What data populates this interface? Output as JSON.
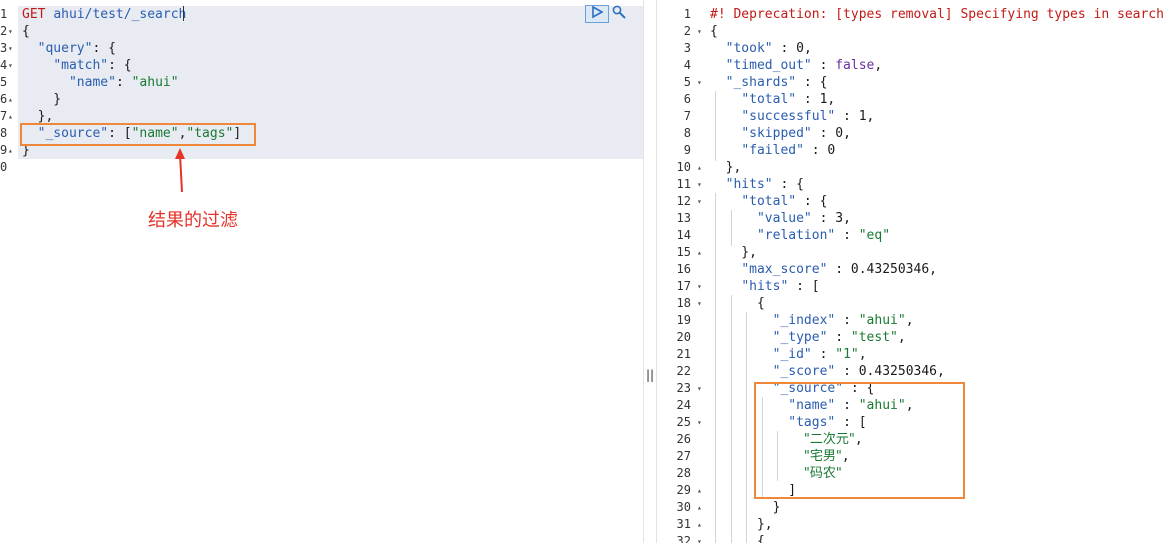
{
  "request": {
    "lines": [
      {
        "n": "1",
        "fold": "",
        "parts": [
          {
            "c": "meth",
            "t": "GET "
          },
          {
            "c": "url",
            "t": "ahui/test/_search"
          }
        ]
      },
      {
        "n": "2",
        "fold": "▾",
        "parts": [
          {
            "c": "pun",
            "t": "{"
          }
        ]
      },
      {
        "n": "3",
        "fold": "▾",
        "parts": [
          {
            "c": "pun",
            "t": "  "
          },
          {
            "c": "key",
            "t": "\"query\""
          },
          {
            "c": "pun",
            "t": ": {"
          }
        ]
      },
      {
        "n": "4",
        "fold": "▾",
        "parts": [
          {
            "c": "pun",
            "t": "    "
          },
          {
            "c": "key",
            "t": "\"match\""
          },
          {
            "c": "pun",
            "t": ": {"
          }
        ]
      },
      {
        "n": "5",
        "fold": "",
        "parts": [
          {
            "c": "pun",
            "t": "      "
          },
          {
            "c": "key",
            "t": "\"name\""
          },
          {
            "c": "pun",
            "t": ": "
          },
          {
            "c": "str",
            "t": "\"ahui\""
          }
        ]
      },
      {
        "n": "6",
        "fold": "▴",
        "parts": [
          {
            "c": "pun",
            "t": "    }"
          }
        ]
      },
      {
        "n": "7",
        "fold": "▴",
        "parts": [
          {
            "c": "pun",
            "t": "  },"
          }
        ]
      },
      {
        "n": "8",
        "fold": "",
        "parts": [
          {
            "c": "pun",
            "t": "  "
          },
          {
            "c": "key",
            "t": "\"_source\""
          },
          {
            "c": "pun",
            "t": ": ["
          },
          {
            "c": "str",
            "t": "\"name\""
          },
          {
            "c": "pun",
            "t": ","
          },
          {
            "c": "str",
            "t": "\"tags\""
          },
          {
            "c": "pun",
            "t": "]"
          }
        ]
      },
      {
        "n": "9",
        "fold": "▴",
        "parts": [
          {
            "c": "pun",
            "t": "}"
          }
        ]
      },
      {
        "n": "0",
        "fold": "",
        "parts": []
      }
    ],
    "annotation": "结果的过滤"
  },
  "response": {
    "lines": [
      {
        "n": "1",
        "fold": "",
        "parts": [
          {
            "c": "cmt",
            "t": "#! Deprecation: [types removal] Specifying types in search r"
          }
        ]
      },
      {
        "n": "2",
        "fold": "▾",
        "parts": [
          {
            "c": "pun",
            "t": "{"
          }
        ]
      },
      {
        "n": "3",
        "fold": "",
        "parts": [
          {
            "c": "pun",
            "t": "  "
          },
          {
            "c": "key",
            "t": "\"took\""
          },
          {
            "c": "pun",
            "t": " : "
          },
          {
            "c": "num",
            "t": "0"
          },
          {
            "c": "pun",
            "t": ","
          }
        ]
      },
      {
        "n": "4",
        "fold": "",
        "parts": [
          {
            "c": "pun",
            "t": "  "
          },
          {
            "c": "key",
            "t": "\"timed_out\""
          },
          {
            "c": "pun",
            "t": " : "
          },
          {
            "c": "kw",
            "t": "false"
          },
          {
            "c": "pun",
            "t": ","
          }
        ]
      },
      {
        "n": "5",
        "fold": "▾",
        "parts": [
          {
            "c": "pun",
            "t": "  "
          },
          {
            "c": "key",
            "t": "\"_shards\""
          },
          {
            "c": "pun",
            "t": " : {"
          }
        ]
      },
      {
        "n": "6",
        "fold": "",
        "parts": [
          {
            "c": "pun",
            "t": "    "
          },
          {
            "c": "key",
            "t": "\"total\""
          },
          {
            "c": "pun",
            "t": " : "
          },
          {
            "c": "num",
            "t": "1"
          },
          {
            "c": "pun",
            "t": ","
          }
        ]
      },
      {
        "n": "7",
        "fold": "",
        "parts": [
          {
            "c": "pun",
            "t": "    "
          },
          {
            "c": "key",
            "t": "\"successful\""
          },
          {
            "c": "pun",
            "t": " : "
          },
          {
            "c": "num",
            "t": "1"
          },
          {
            "c": "pun",
            "t": ","
          }
        ]
      },
      {
        "n": "8",
        "fold": "",
        "parts": [
          {
            "c": "pun",
            "t": "    "
          },
          {
            "c": "key",
            "t": "\"skipped\""
          },
          {
            "c": "pun",
            "t": " : "
          },
          {
            "c": "num",
            "t": "0"
          },
          {
            "c": "pun",
            "t": ","
          }
        ]
      },
      {
        "n": "9",
        "fold": "",
        "parts": [
          {
            "c": "pun",
            "t": "    "
          },
          {
            "c": "key",
            "t": "\"failed\""
          },
          {
            "c": "pun",
            "t": " : "
          },
          {
            "c": "num",
            "t": "0"
          }
        ]
      },
      {
        "n": "10",
        "fold": "▴",
        "parts": [
          {
            "c": "pun",
            "t": "  },"
          }
        ]
      },
      {
        "n": "11",
        "fold": "▾",
        "parts": [
          {
            "c": "pun",
            "t": "  "
          },
          {
            "c": "key",
            "t": "\"hits\""
          },
          {
            "c": "pun",
            "t": " : {"
          }
        ]
      },
      {
        "n": "12",
        "fold": "▾",
        "parts": [
          {
            "c": "pun",
            "t": "    "
          },
          {
            "c": "key",
            "t": "\"total\""
          },
          {
            "c": "pun",
            "t": " : {"
          }
        ]
      },
      {
        "n": "13",
        "fold": "",
        "parts": [
          {
            "c": "pun",
            "t": "      "
          },
          {
            "c": "key",
            "t": "\"value\""
          },
          {
            "c": "pun",
            "t": " : "
          },
          {
            "c": "num",
            "t": "3"
          },
          {
            "c": "pun",
            "t": ","
          }
        ]
      },
      {
        "n": "14",
        "fold": "",
        "parts": [
          {
            "c": "pun",
            "t": "      "
          },
          {
            "c": "key",
            "t": "\"relation\""
          },
          {
            "c": "pun",
            "t": " : "
          },
          {
            "c": "str",
            "t": "\"eq\""
          }
        ]
      },
      {
        "n": "15",
        "fold": "▴",
        "parts": [
          {
            "c": "pun",
            "t": "    },"
          }
        ]
      },
      {
        "n": "16",
        "fold": "",
        "parts": [
          {
            "c": "pun",
            "t": "    "
          },
          {
            "c": "key",
            "t": "\"max_score\""
          },
          {
            "c": "pun",
            "t": " : "
          },
          {
            "c": "num",
            "t": "0.43250346"
          },
          {
            "c": "pun",
            "t": ","
          }
        ]
      },
      {
        "n": "17",
        "fold": "▾",
        "parts": [
          {
            "c": "pun",
            "t": "    "
          },
          {
            "c": "key",
            "t": "\"hits\""
          },
          {
            "c": "pun",
            "t": " : ["
          }
        ]
      },
      {
        "n": "18",
        "fold": "▾",
        "parts": [
          {
            "c": "pun",
            "t": "      {"
          }
        ]
      },
      {
        "n": "19",
        "fold": "",
        "parts": [
          {
            "c": "pun",
            "t": "        "
          },
          {
            "c": "key",
            "t": "\"_index\""
          },
          {
            "c": "pun",
            "t": " : "
          },
          {
            "c": "str",
            "t": "\"ahui\""
          },
          {
            "c": "pun",
            "t": ","
          }
        ]
      },
      {
        "n": "20",
        "fold": "",
        "parts": [
          {
            "c": "pun",
            "t": "        "
          },
          {
            "c": "key",
            "t": "\"_type\""
          },
          {
            "c": "pun",
            "t": " : "
          },
          {
            "c": "str",
            "t": "\"test\""
          },
          {
            "c": "pun",
            "t": ","
          }
        ]
      },
      {
        "n": "21",
        "fold": "",
        "parts": [
          {
            "c": "pun",
            "t": "        "
          },
          {
            "c": "key",
            "t": "\"_id\""
          },
          {
            "c": "pun",
            "t": " : "
          },
          {
            "c": "str",
            "t": "\"1\""
          },
          {
            "c": "pun",
            "t": ","
          }
        ]
      },
      {
        "n": "22",
        "fold": "",
        "parts": [
          {
            "c": "pun",
            "t": "        "
          },
          {
            "c": "key",
            "t": "\"_score\""
          },
          {
            "c": "pun",
            "t": " : "
          },
          {
            "c": "num",
            "t": "0.43250346"
          },
          {
            "c": "pun",
            "t": ","
          }
        ]
      },
      {
        "n": "23",
        "fold": "▾",
        "parts": [
          {
            "c": "pun",
            "t": "        "
          },
          {
            "c": "key",
            "t": "\"_source\""
          },
          {
            "c": "pun",
            "t": " : {"
          }
        ]
      },
      {
        "n": "24",
        "fold": "",
        "parts": [
          {
            "c": "pun",
            "t": "          "
          },
          {
            "c": "key",
            "t": "\"name\""
          },
          {
            "c": "pun",
            "t": " : "
          },
          {
            "c": "str",
            "t": "\"ahui\""
          },
          {
            "c": "pun",
            "t": ","
          }
        ]
      },
      {
        "n": "25",
        "fold": "▾",
        "parts": [
          {
            "c": "pun",
            "t": "          "
          },
          {
            "c": "key",
            "t": "\"tags\""
          },
          {
            "c": "pun",
            "t": " : ["
          }
        ]
      },
      {
        "n": "26",
        "fold": "",
        "parts": [
          {
            "c": "pun",
            "t": "            "
          },
          {
            "c": "str cjk",
            "t": "\"二次元\""
          },
          {
            "c": "pun",
            "t": ","
          }
        ]
      },
      {
        "n": "27",
        "fold": "",
        "parts": [
          {
            "c": "pun",
            "t": "            "
          },
          {
            "c": "str cjk",
            "t": "\"宅男\""
          },
          {
            "c": "pun",
            "t": ","
          }
        ]
      },
      {
        "n": "28",
        "fold": "",
        "parts": [
          {
            "c": "pun",
            "t": "            "
          },
          {
            "c": "str cjk",
            "t": "\"码农\""
          }
        ]
      },
      {
        "n": "29",
        "fold": "▴",
        "parts": [
          {
            "c": "pun",
            "t": "          ]"
          }
        ]
      },
      {
        "n": "30",
        "fold": "▴",
        "parts": [
          {
            "c": "pun",
            "t": "        }"
          }
        ]
      },
      {
        "n": "31",
        "fold": "▴",
        "parts": [
          {
            "c": "pun",
            "t": "      },"
          }
        ]
      },
      {
        "n": "32",
        "fold": "▾",
        "parts": [
          {
            "c": "pun",
            "t": "      {"
          }
        ]
      }
    ]
  },
  "toolbar": {
    "play_icon": "play-icon",
    "wrench_icon": "wrench-icon"
  },
  "divider": {
    "handle": "||"
  },
  "colors": {
    "highlight": "#f0883c",
    "annotation": "#e5332a",
    "string": "#1a7a34",
    "key": "#2a5db0"
  }
}
